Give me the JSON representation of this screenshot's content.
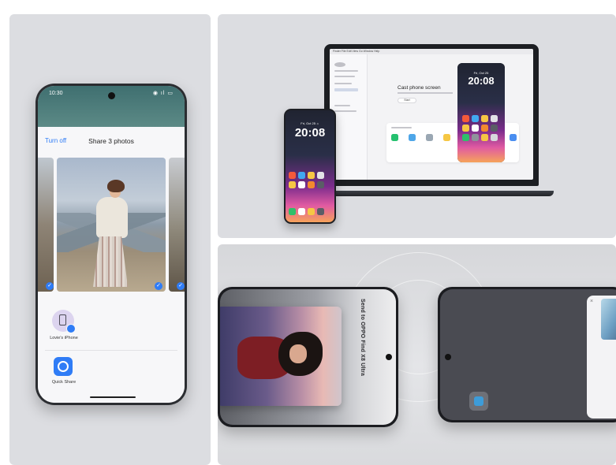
{
  "left_phone": {
    "status_time": "10:30",
    "status_icons": "◉ ıl ▭",
    "share_sheet": {
      "turn_off_label": "Turn off",
      "title": "Share 3 photos",
      "check_glyph": "✓",
      "targets": [
        {
          "name": "Lovie's iPhone",
          "icon": "phone-share-icon"
        },
        {
          "name": "Quick Share",
          "icon": "quick-share-icon"
        }
      ]
    }
  },
  "laptop": {
    "menubar": "Finder   File   Edit   View   Go   Window   Help",
    "cast_title": "Cast phone screen",
    "cast_button": "Start"
  },
  "small_phone": {
    "date": "Fri, Oct 25 ☼",
    "time": "20:08"
  },
  "mirror_phone": {
    "date": "Fri, Oct 25",
    "time": "20:08"
  },
  "transfer": {
    "send_text": "Send to OPPO Find X8 Ultra",
    "close_glyph": "×"
  },
  "colors": {
    "accent_blue": "#2f7cf6",
    "panel_gray": "#dcdde1"
  }
}
